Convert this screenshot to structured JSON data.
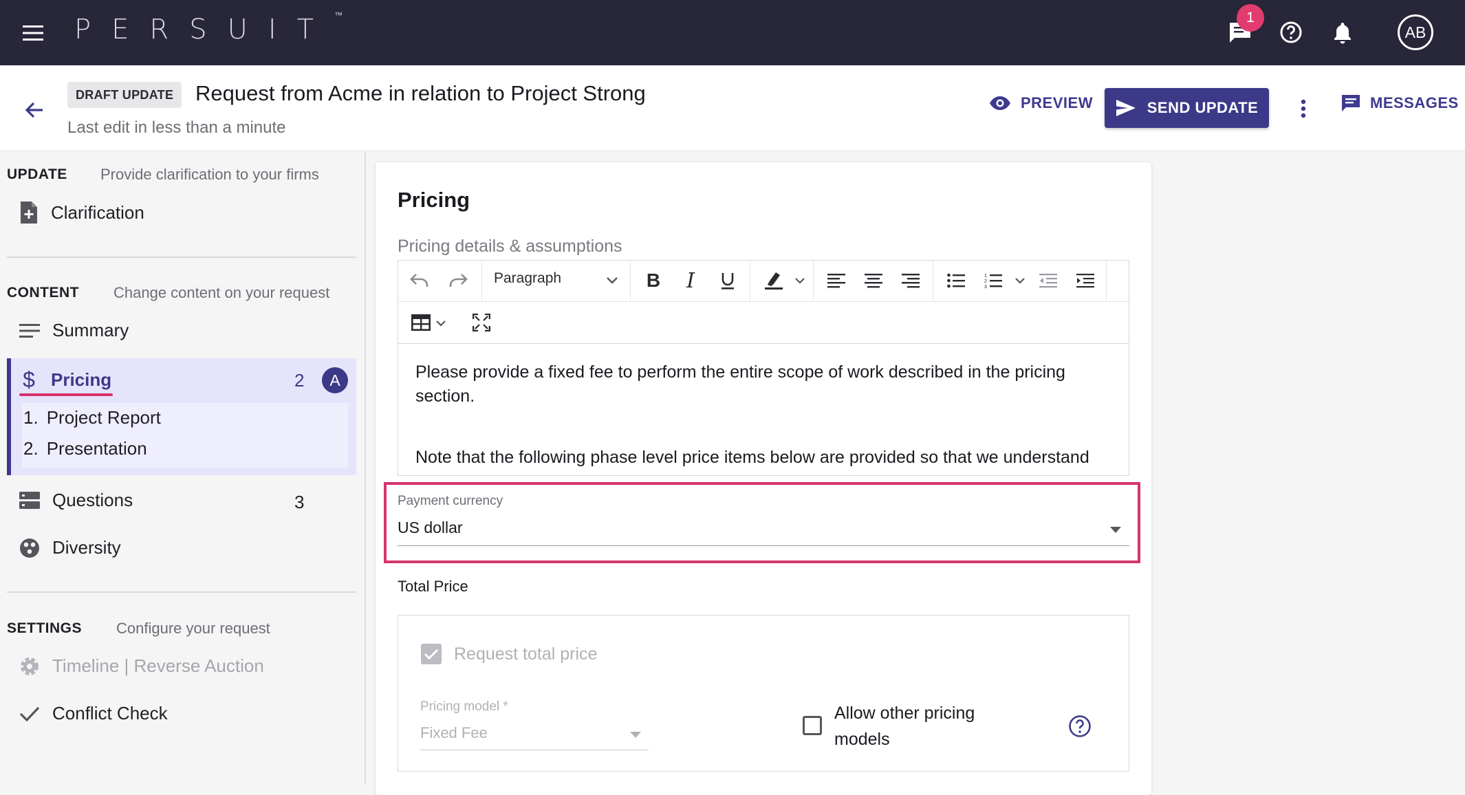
{
  "topbar": {
    "logo": "PERSUIT",
    "logo_tm": "™",
    "chat_badge": "1",
    "avatar_initials": "AB",
    "icons": [
      "menu-icon",
      "chat-icon",
      "help-icon",
      "bell-icon"
    ]
  },
  "header": {
    "status": "DRAFT UPDATE",
    "title": "Request from Acme in relation to Project Strong",
    "subtitle": "Last edit in less than a minute",
    "preview_label": "PREVIEW",
    "send_label": "SEND UPDATE",
    "messages_label": "MESSAGES"
  },
  "sidebar": {
    "update": {
      "heading": "UPDATE",
      "sub": "Provide clarification to your firms",
      "items": [
        {
          "label": "Clarification"
        }
      ]
    },
    "content": {
      "heading": "CONTENT",
      "sub": "Change content on your request",
      "items": [
        {
          "label": "Summary"
        },
        {
          "label": "Pricing",
          "count": "2",
          "badge": "A"
        },
        {
          "label": "Questions",
          "count": "3"
        },
        {
          "label": "Diversity"
        }
      ],
      "pricing_subitems": [
        {
          "num": "1.",
          "label": "Project Report"
        },
        {
          "num": "2.",
          "label": "Presentation"
        }
      ]
    },
    "settings": {
      "heading": "SETTINGS",
      "sub": "Configure your request",
      "items": [
        {
          "label": "Timeline | Reverse Auction"
        },
        {
          "label": "Conflict Check"
        }
      ]
    }
  },
  "main": {
    "section_title": "Pricing",
    "details_label": "Pricing details & assumptions",
    "toolbar": {
      "paragraph_select": "Paragraph"
    },
    "editor_paragraphs": [
      "Please provide a fixed fee to perform the entire scope of work described in the pricing section.",
      "Note that the following phase level price items below are provided so that we understand"
    ],
    "currency": {
      "label": "Payment currency",
      "value": "US dollar"
    },
    "total_price": {
      "label": "Total Price",
      "request_total_label": "Request total price",
      "pricing_model_label": "Pricing model *",
      "pricing_model_value": "Fixed Fee",
      "allow_other_label_line1": "Allow other pricing",
      "allow_other_label_line2": "models"
    }
  },
  "colors": {
    "topbar": "#282639",
    "accent": "#3d3989",
    "highlight": "#d6336f",
    "badge": "#e23b6f"
  }
}
